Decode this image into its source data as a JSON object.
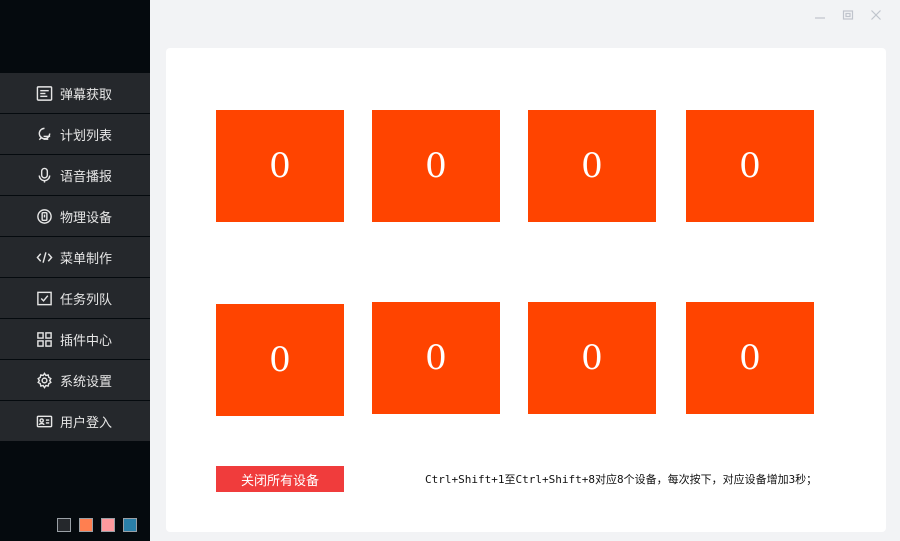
{
  "sidebar": {
    "items": [
      {
        "label": "弹幕获取",
        "icon": "subtitle-icon"
      },
      {
        "label": "计划列表",
        "icon": "plan-icon"
      },
      {
        "label": "语音播报",
        "icon": "microphone-icon"
      },
      {
        "label": "物理设备",
        "icon": "device-icon"
      },
      {
        "label": "菜单制作",
        "icon": "code-icon"
      },
      {
        "label": "任务列队",
        "icon": "checkbox-icon"
      },
      {
        "label": "插件中心",
        "icon": "grid-icon"
      },
      {
        "label": "系统设置",
        "icon": "gear-icon"
      },
      {
        "label": "用户登入",
        "icon": "id-card-icon"
      }
    ],
    "theme_swatches": [
      "#25282c",
      "#ff7f50",
      "#ff9a9e",
      "#2a7fa8"
    ]
  },
  "counters": [
    "0",
    "0",
    "0",
    "0",
    "0",
    "0",
    "0",
    "0"
  ],
  "colors": {
    "counter": "#ff4400",
    "button": "#f03c3c",
    "sidebar": "#050a0e",
    "menu_item": "#25282c"
  },
  "controls": {
    "close_all_label": "关闭所有设备",
    "hint": "Ctrl+Shift+1至Ctrl+Shift+8对应8个设备，每次按下，对应设备增加3秒；"
  }
}
